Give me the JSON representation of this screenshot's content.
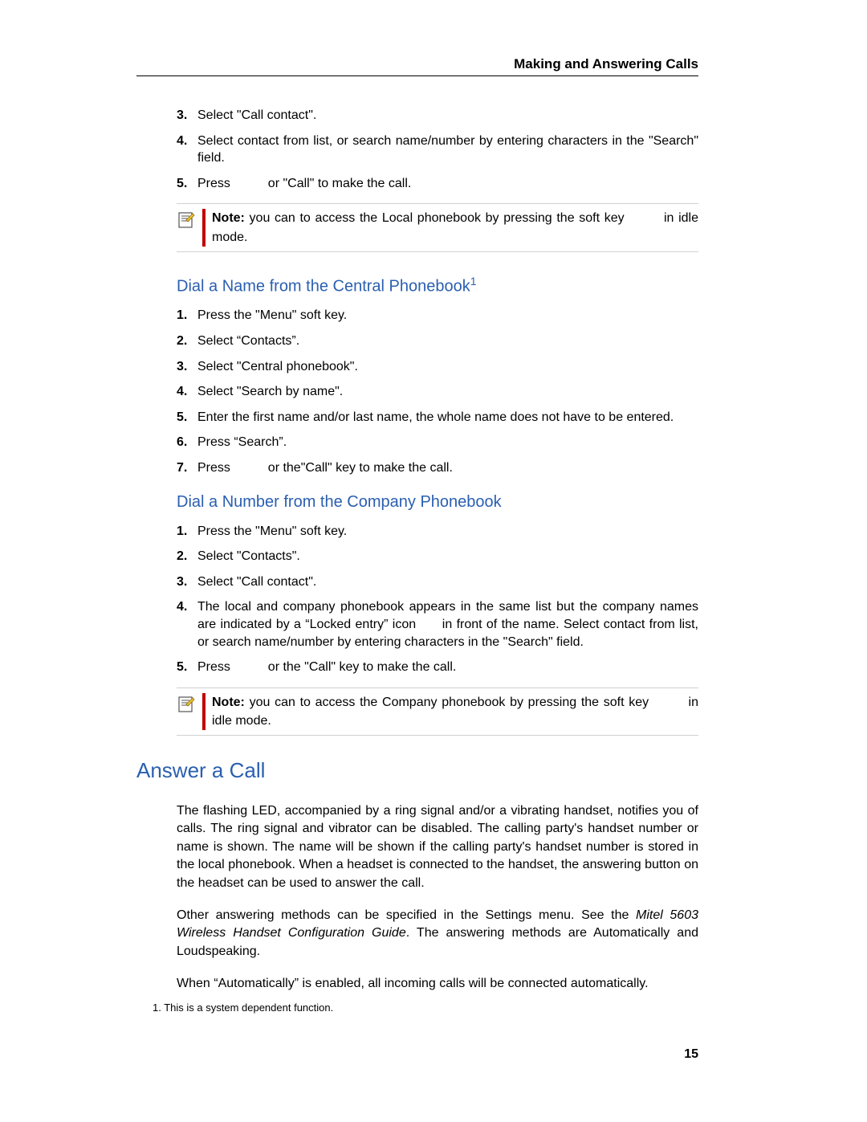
{
  "header": {
    "title": "Making and Answering Calls"
  },
  "section_a": {
    "steps": [
      {
        "num": "3.",
        "text": "Select \"Call contact\"."
      },
      {
        "num": "4.",
        "text": "Select contact from list, or search name/number by entering characters in the \"Search\" field."
      },
      {
        "num": "5.",
        "text_a": "Press ",
        "text_b": " or \"Call\" to make the call."
      }
    ],
    "note": {
      "bold": "Note:",
      "text_a": " you can to access the Local phonebook by pressing the soft key ",
      "text_b": " in idle mode."
    }
  },
  "section_b": {
    "heading": "Dial a Name from the Central Phonebook",
    "footref": "1",
    "steps": [
      {
        "num": "1.",
        "text": "Press the \"Menu\" soft key."
      },
      {
        "num": "2.",
        "text": "Select “Contacts”."
      },
      {
        "num": "3.",
        "text": "Select \"Central phonebook\"."
      },
      {
        "num": "4.",
        "text": "Select \"Search by name\"."
      },
      {
        "num": "5.",
        "text": "Enter the first name and/or last name, the whole name does not have to be entered."
      },
      {
        "num": "6.",
        "text": "Press “Search”."
      },
      {
        "num": "7.",
        "text_a": "Press ",
        "text_b": " or the\"Call\" key to make the call."
      }
    ]
  },
  "section_c": {
    "heading": "Dial a Number from the Company Phonebook",
    "steps": [
      {
        "num": "1.",
        "text": "Press the \"Menu\" soft key."
      },
      {
        "num": "2.",
        "text": "Select \"Contacts\"."
      },
      {
        "num": "3.",
        "text": "Select \"Call contact\"."
      },
      {
        "num": "4.",
        "text_a": "The local and company phonebook appears in the same list but the company names are indicated by a “Locked entry” icon ",
        "text_b": " in front of the name. Select contact from list, or search name/number by entering characters in the \"Search\" field."
      },
      {
        "num": "5.",
        "text_a": "Press ",
        "text_b": " or the \"Call\" key to make the call."
      }
    ],
    "note": {
      "bold": "Note:",
      "text_a": " you can to access the Company phonebook by pressing the soft key ",
      "text_b": " in idle mode."
    }
  },
  "section_d": {
    "heading": "Answer a Call",
    "para1": "The flashing LED, accompanied by a ring signal and/or a vibrating handset, notifies you of calls. The ring signal and vibrator can be disabled. The calling party's handset number or name is shown. The name will be shown if the calling party's handset number is stored in the local phonebook. When a headset is connected to the handset, the answering button on the headset can be used to answer the call.",
    "para2_a": "Other answering methods can be specified in the Settings menu. See the ",
    "para2_italic": "Mitel 5603 Wireless Handset Configuration Guide",
    "para2_b": ". The answering methods are Automatically and Loudspeaking.",
    "para3": "When “Automatically” is enabled, all incoming calls will be connected automatically."
  },
  "footnote": {
    "text": "1.  This is a system dependent function."
  },
  "page_number": "15"
}
